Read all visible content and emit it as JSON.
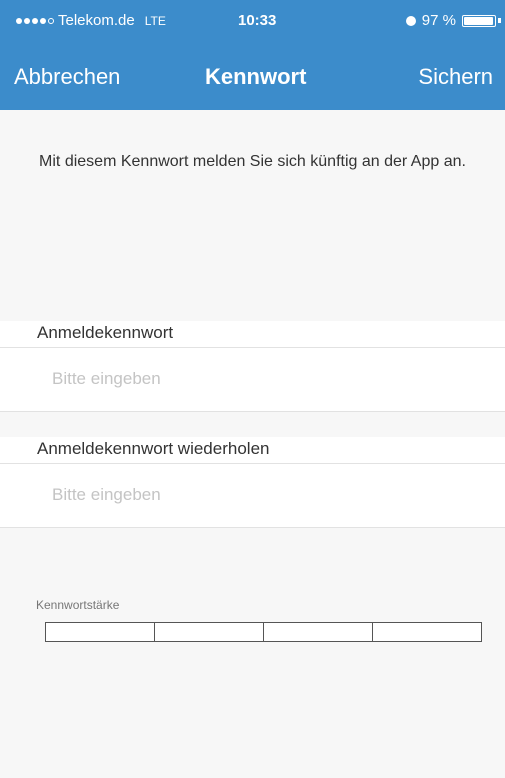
{
  "status_bar": {
    "carrier": "Telekom.de",
    "network": "LTE",
    "time": "10:33",
    "battery_percent": "97 %",
    "battery_level": 0.97
  },
  "nav": {
    "left_button": "Abbrechen",
    "title": "Kennwort",
    "right_button": "Sichern"
  },
  "info": {
    "text": "Mit diesem Kennwort melden Sie sich künftig an der App an."
  },
  "fields": [
    {
      "label": "Anmeldekennwort",
      "value": "",
      "placeholder": "Bitte eingeben"
    },
    {
      "label": "Anmeldekennwort wiederholen",
      "value": "",
      "placeholder": "Bitte eingeben"
    }
  ],
  "strength": {
    "label": "Kennwortstärke",
    "level": 0,
    "segments": 4
  },
  "colors": {
    "accent": "#3c8ccb",
    "background": "#f7f7f7"
  }
}
